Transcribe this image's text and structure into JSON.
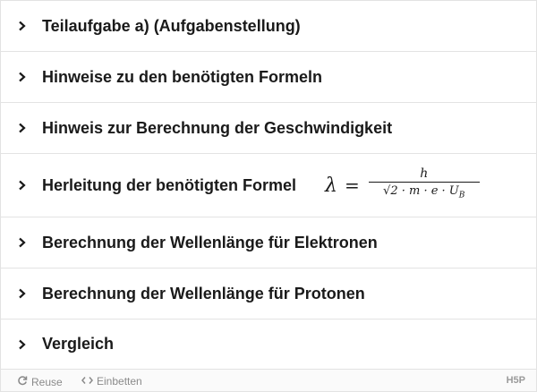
{
  "accordion": {
    "panels": [
      {
        "title": "Teilaufgabe a) (Aufgabenstellung)"
      },
      {
        "title": "Hinweise zu den benötigten Formeln"
      },
      {
        "title": "Hinweis zur Berechnung der Geschwindigkeit"
      },
      {
        "title": "Herleitung der benötigten Formel",
        "formula": {
          "lhs": "λ",
          "eq": "=",
          "numerator": "h",
          "denominator": "√2 · m · e · U",
          "subscript": "B"
        }
      },
      {
        "title": "Berechnung der Wellenlänge für Elektronen"
      },
      {
        "title": "Berechnung der Wellenlänge für Protonen"
      },
      {
        "title": "Vergleich"
      }
    ],
    "icon": "chevron-right-icon"
  },
  "footer": {
    "reuse_label": "Reuse",
    "embed_label": "Einbetten",
    "logo": "H5P"
  },
  "colors": {
    "text": "#1a1a1a",
    "border": "#e3e3e3",
    "footer_bg": "#fafafa",
    "footer_text": "#8a8a8a"
  }
}
